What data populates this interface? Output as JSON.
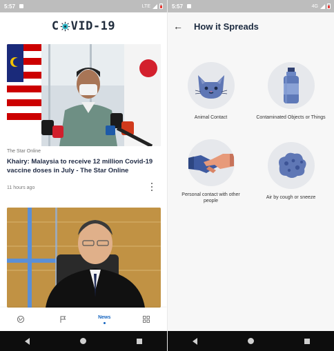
{
  "left_screen": {
    "status": {
      "time": "5:57",
      "network": "LTE"
    },
    "app_title_pre": "C",
    "app_title_post": "VID-19",
    "articles": [
      {
        "source": "The Star Online",
        "headline": "Khairy: Malaysia to receive 12 million Covid-19 vaccine doses in July - The Star Online",
        "time_ago": "11 hours ago"
      }
    ],
    "bottom_nav": [
      {
        "label": "",
        "icon": "globe-icon"
      },
      {
        "label": "",
        "icon": "flag-icon"
      },
      {
        "label": "News",
        "icon": "news",
        "active": true
      },
      {
        "label": "",
        "icon": "grid-icon"
      }
    ]
  },
  "right_screen": {
    "status": {
      "time": "5:57",
      "network": "4G"
    },
    "title": "How it Spreads",
    "items": [
      {
        "label": "Animal Contact",
        "icon": "cat-icon"
      },
      {
        "label": "Contaminated Objects or Things",
        "icon": "bottle-icon"
      },
      {
        "label": "Personal contact with other people",
        "icon": "handshake-icon"
      },
      {
        "label": "Air by cough or sneeze",
        "icon": "virus-cloud-icon"
      }
    ]
  },
  "colors": {
    "accent": "#1565c0",
    "title": "#1b2a3f",
    "virus": "#2bb4c4"
  }
}
